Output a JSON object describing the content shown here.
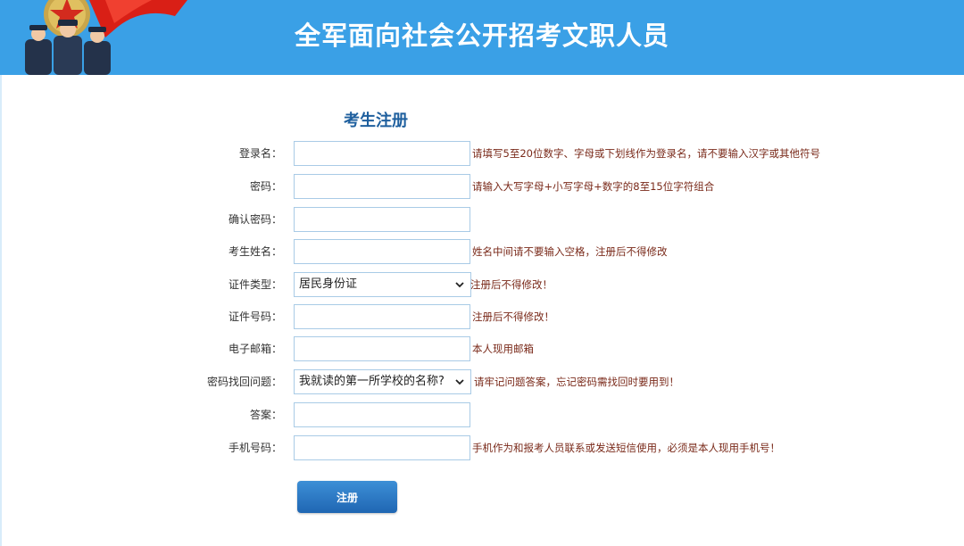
{
  "header": {
    "title": "全军面向社会公开招考文职人员",
    "color": "#3aa0e6"
  },
  "form": {
    "title": "考生注册",
    "fields": {
      "username": {
        "label": "登录名：",
        "value": "",
        "hint": "请填写5至20位数字、字母或下划线作为登录名，请不要输入汉字或其他符号"
      },
      "password": {
        "label": "密码：",
        "value": "",
        "hint": "请输入大写字母+小写字母+数字的8至15位字符组合"
      },
      "confirm_password": {
        "label": "确认密码：",
        "value": ""
      },
      "name": {
        "label": "考生姓名：",
        "value": "",
        "hint": "姓名中间请不要输入空格，注册后不得修改"
      },
      "id_type": {
        "label": "证件类型：",
        "selected": "居民身份证",
        "hint": "注册后不得修改！"
      },
      "id_number": {
        "label": "证件号码：",
        "value": "",
        "hint": "注册后不得修改！"
      },
      "email": {
        "label": "电子邮箱：",
        "value": "",
        "hint": "本人现用邮箱"
      },
      "security_question": {
        "label": "密码找回问题：",
        "selected": "我就读的第一所学校的名称?",
        "hint": "请牢记问题答案，忘记密码需找回时要用到！"
      },
      "answer": {
        "label": "答案：",
        "value": ""
      },
      "phone": {
        "label": "手机号码：",
        "value": "",
        "hint": "手机作为和报考人员联系或发送短信使用，必须是本人现用手机号！"
      }
    },
    "submit_label": "注册"
  },
  "icons": {
    "banner": "army-emblem-soldiers",
    "dropdown": "chevron-down-icon"
  }
}
